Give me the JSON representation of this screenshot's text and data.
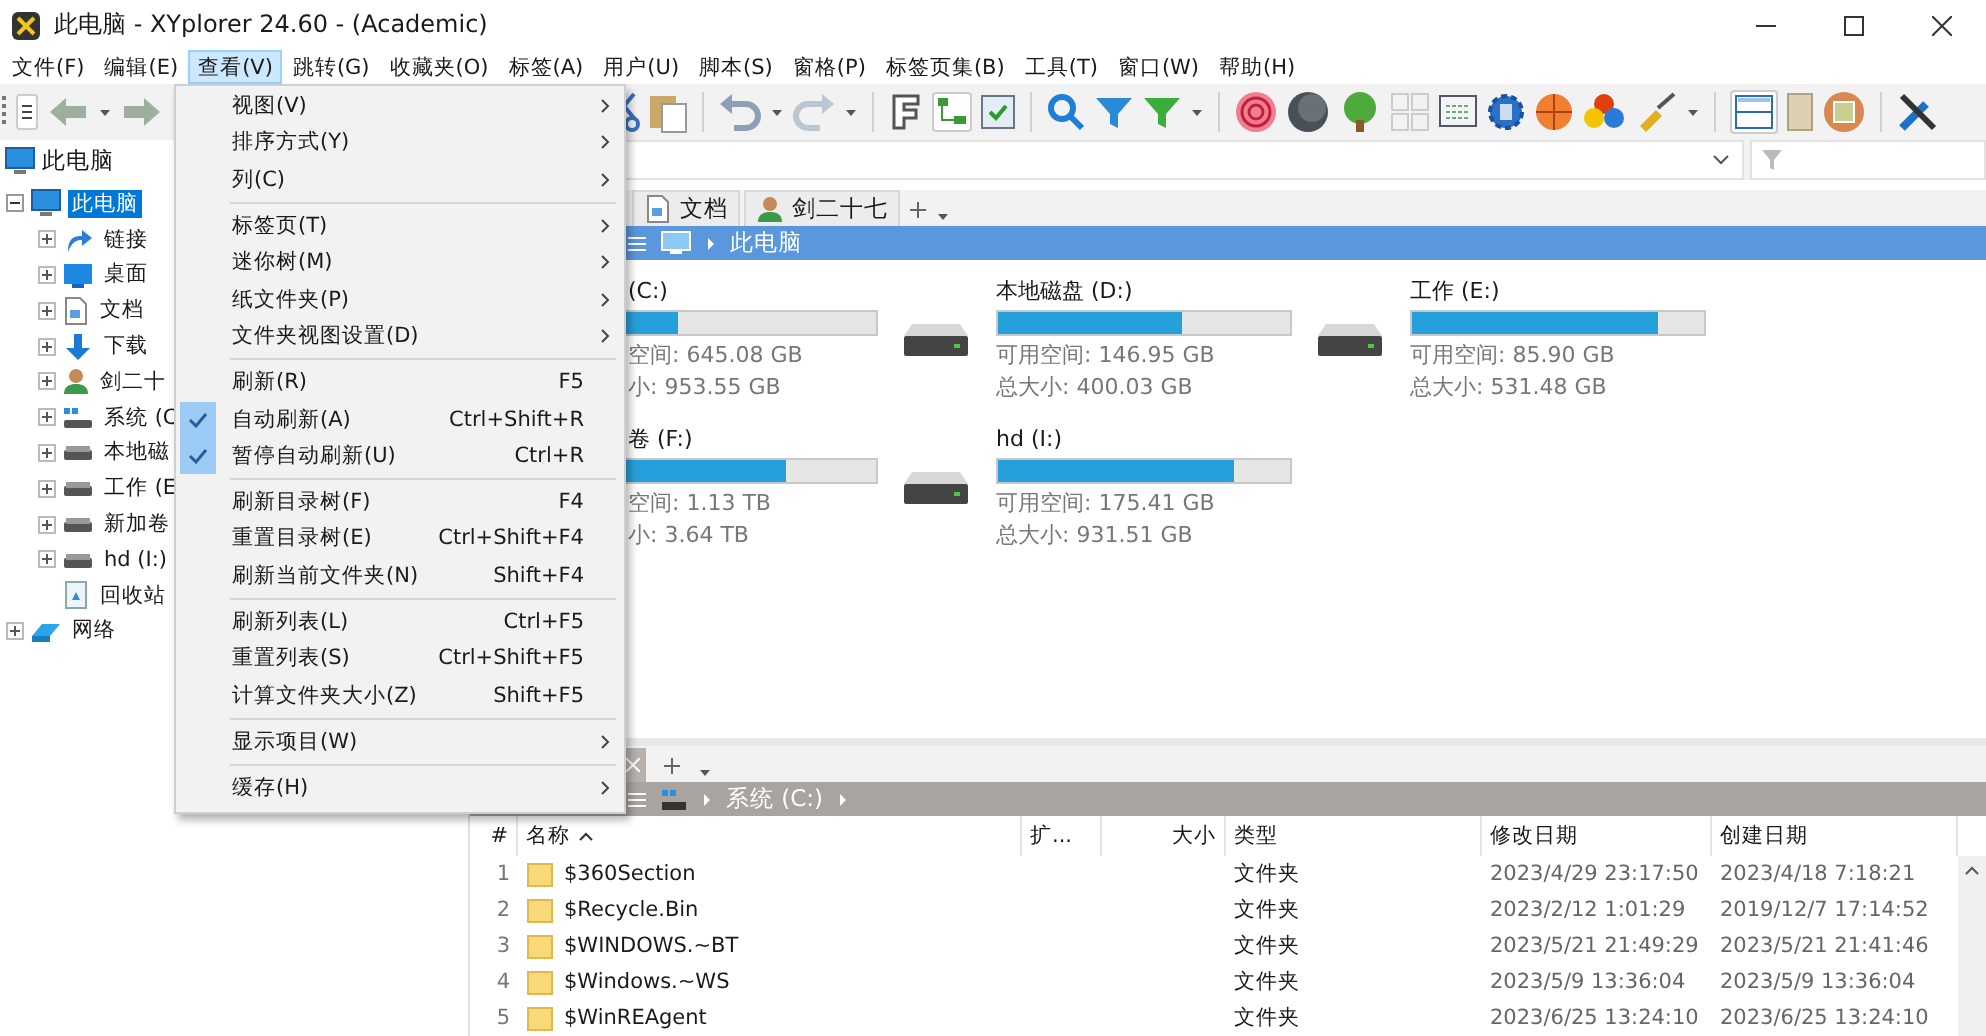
{
  "window": {
    "title": "此电脑 - XYplorer 24.60 - (Academic)"
  },
  "menu_bar": [
    {
      "label": "文件(F)",
      "selected": false
    },
    {
      "label": "编辑(E)",
      "selected": false
    },
    {
      "label": "查看(V)",
      "selected": true
    },
    {
      "label": "跳转(G)",
      "selected": false
    },
    {
      "label": "收藏夹(O)",
      "selected": false
    },
    {
      "label": "标签(A)",
      "selected": false
    },
    {
      "label": "用户(U)",
      "selected": false
    },
    {
      "label": "脚本(S)",
      "selected": false
    },
    {
      "label": "窗格(P)",
      "selected": false
    },
    {
      "label": "标签页集(B)",
      "selected": false
    },
    {
      "label": "工具(T)",
      "selected": false
    },
    {
      "label": "窗口(W)",
      "selected": false
    },
    {
      "label": "帮助(H)",
      "selected": false
    }
  ],
  "view_menu": [
    {
      "kind": "item",
      "label": "视图(V)",
      "submenu": true,
      "checked": false
    },
    {
      "kind": "item",
      "label": "排序方式(Y)",
      "submenu": true,
      "checked": false
    },
    {
      "kind": "item",
      "label": "列(C)",
      "submenu": true,
      "checked": false
    },
    {
      "kind": "separator"
    },
    {
      "kind": "item",
      "label": "标签页(T)",
      "submenu": true,
      "checked": false
    },
    {
      "kind": "item",
      "label": "迷你树(M)",
      "submenu": true,
      "checked": false
    },
    {
      "kind": "item",
      "label": "纸文件夹(P)",
      "submenu": true,
      "checked": false
    },
    {
      "kind": "item",
      "label": "文件夹视图设置(D)",
      "submenu": true,
      "checked": false
    },
    {
      "kind": "separator"
    },
    {
      "kind": "item",
      "label": "刷新(R)",
      "shortcut": "F5",
      "checked": false
    },
    {
      "kind": "item",
      "label": "自动刷新(A)",
      "shortcut": "Ctrl+Shift+R",
      "checked": true
    },
    {
      "kind": "item",
      "label": "暂停自动刷新(U)",
      "shortcut": "Ctrl+R",
      "checked": true
    },
    {
      "kind": "separator"
    },
    {
      "kind": "item",
      "label": "刷新目录树(F)",
      "shortcut": "F4",
      "checked": false
    },
    {
      "kind": "item",
      "label": "重置目录树(E)",
      "shortcut": "Ctrl+Shift+F4",
      "checked": false
    },
    {
      "kind": "item",
      "label": "刷新当前文件夹(N)",
      "shortcut": "Shift+F4",
      "checked": false
    },
    {
      "kind": "separator"
    },
    {
      "kind": "item",
      "label": "刷新列表(L)",
      "shortcut": "Ctrl+F5",
      "checked": false
    },
    {
      "kind": "item",
      "label": "重置列表(S)",
      "shortcut": "Ctrl+Shift+F5",
      "checked": false
    },
    {
      "kind": "item",
      "label": "计算文件夹大小(Z)",
      "shortcut": "Shift+F5",
      "checked": false
    },
    {
      "kind": "separator"
    },
    {
      "kind": "item",
      "label": "显示项目(W)",
      "submenu": true,
      "checked": false
    },
    {
      "kind": "separator"
    },
    {
      "kind": "item",
      "label": "缓存(H)",
      "submenu": true,
      "checked": false
    }
  ],
  "tree_header": {
    "label": "此电脑"
  },
  "tree": [
    {
      "label": "此电脑",
      "kind": "computer",
      "expanded": true,
      "selected": true,
      "children": [
        {
          "label": "链接",
          "kind": "link",
          "expanded": false,
          "selected": false
        },
        {
          "label": "桌面",
          "kind": "desktop",
          "expanded": false,
          "selected": false
        },
        {
          "label": "文档",
          "kind": "document",
          "expanded": false,
          "selected": false
        },
        {
          "label": "下载",
          "kind": "download",
          "expanded": false,
          "selected": false
        },
        {
          "label": "剑二十",
          "kind": "user",
          "expanded": false,
          "selected": false
        },
        {
          "label": "系统 (C",
          "kind": "system-drive",
          "expanded": false,
          "selected": false
        },
        {
          "label": "本地磁",
          "kind": "drive",
          "expanded": false,
          "selected": false
        },
        {
          "label": "工作 (E",
          "kind": "drive",
          "expanded": false,
          "selected": false
        },
        {
          "label": "新加卷",
          "kind": "drive",
          "expanded": false,
          "selected": false
        },
        {
          "label": "hd (I:)",
          "kind": "drive",
          "expanded": false,
          "selected": false
        },
        {
          "label": "回收站",
          "kind": "recycle-bin",
          "selected": false
        }
      ]
    },
    {
      "label": "网络",
      "kind": "network",
      "expanded": false,
      "selected": false
    }
  ],
  "upper_pane": {
    "tabs": [
      {
        "label": "文档",
        "kind": "document",
        "selected": false
      },
      {
        "label": "剑二十七",
        "kind": "user",
        "selected": false
      }
    ],
    "breadcrumb": "此电脑",
    "drives": [
      {
        "kind": "partial",
        "label": "(C:)",
        "free": "空间: 645.08 GB",
        "total": "小: 953.55 GB",
        "level": 0.32
      },
      {
        "kind": "drive",
        "label": "本地磁盘 (D:)",
        "free": "可用空间: 146.95 GB",
        "total": "总大小: 400.03 GB",
        "level": 0.63
      },
      {
        "kind": "drive",
        "label": "工作 (E:)",
        "free": "可用空间: 85.90 GB",
        "total": "总大小: 531.48 GB",
        "level": 0.84
      },
      {
        "kind": "partial",
        "label": "卷 (F:)",
        "free": "空间: 1.13 TB",
        "total": "小: 3.64 TB",
        "level": 0.69
      },
      {
        "kind": "drive",
        "label": "hd (I:)",
        "free": "可用空间: 175.41 GB",
        "total": "总大小: 931.51 GB",
        "level": 0.81
      }
    ]
  },
  "lower_pane": {
    "breadcrumb": "系统 (C:)",
    "columns": [
      "#",
      "名称",
      "扩...",
      "大小",
      "类型",
      "修改日期",
      "创建日期"
    ],
    "rows": [
      {
        "num": "1",
        "name": "$360Section",
        "type": "文件夹",
        "modified": "2023/4/29 23:17:50",
        "created": "2023/4/18 7:18:21"
      },
      {
        "num": "2",
        "name": "$Recycle.Bin",
        "type": "文件夹",
        "modified": "2023/2/12 1:01:29",
        "created": "2019/12/7 17:14:52"
      },
      {
        "num": "3",
        "name": "$WINDOWS.~BT",
        "type": "文件夹",
        "modified": "2023/5/21 21:49:29",
        "created": "2023/5/21 21:41:46"
      },
      {
        "num": "4",
        "name": "$Windows.~WS",
        "type": "文件夹",
        "modified": "2023/5/9 13:36:04",
        "created": "2023/5/9 13:36:04"
      },
      {
        "num": "5",
        "name": "$WinREAgent",
        "type": "文件夹",
        "modified": "2023/6/25 13:24:10",
        "created": "2023/6/25 13:24:10"
      }
    ]
  }
}
